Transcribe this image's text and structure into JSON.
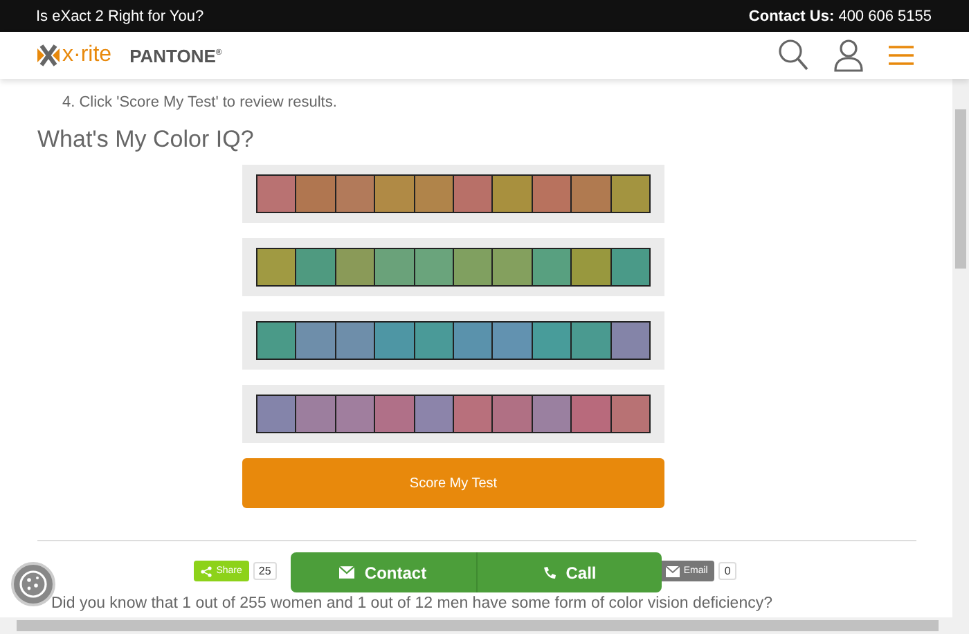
{
  "top_bar": {
    "promo_link": "Is eXact 2 Right for You?",
    "contact_label": "Contact Us:",
    "contact_phone": "400 606 5155"
  },
  "header": {
    "logo_text": "x·rite",
    "brand": "PANTONE",
    "brand_mark": "®"
  },
  "instructions": [
    "4. Click 'Score My Test' to review results."
  ],
  "title": "What's My Color IQ?",
  "swatch_rows": [
    {
      "tiles": [
        {
          "color": "#b97272"
        },
        {
          "color": "#b07650"
        },
        {
          "color": "#b27a5a"
        },
        {
          "color": "#b08a45"
        },
        {
          "color": "#b0844a"
        },
        {
          "color": "#b87068"
        },
        {
          "color": "#a8903e"
        },
        {
          "color": "#b8725e"
        },
        {
          "color": "#b07a50"
        },
        {
          "color": "#a39440"
        }
      ]
    },
    {
      "tiles": [
        {
          "color": "#a09a42"
        },
        {
          "color": "#4f9a80"
        },
        {
          "color": "#8a9a58"
        },
        {
          "color": "#6aa27a"
        },
        {
          "color": "#6aa47c"
        },
        {
          "color": "#80a060"
        },
        {
          "color": "#84a05e"
        },
        {
          "color": "#58a080"
        },
        {
          "color": "#98983e"
        },
        {
          "color": "#4a9a88"
        }
      ]
    },
    {
      "tiles": [
        {
          "color": "#4a9a88"
        },
        {
          "color": "#6e8eaa"
        },
        {
          "color": "#6e8eaa"
        },
        {
          "color": "#4e96a4"
        },
        {
          "color": "#4a9a98"
        },
        {
          "color": "#5a92ac"
        },
        {
          "color": "#6292b0"
        },
        {
          "color": "#489c9a"
        },
        {
          "color": "#4a9a90"
        },
        {
          "color": "#8484a8"
        }
      ]
    },
    {
      "tiles": [
        {
          "color": "#8484aa"
        },
        {
          "color": "#9c7e9e"
        },
        {
          "color": "#a07e9e"
        },
        {
          "color": "#b07088"
        },
        {
          "color": "#8c84aa"
        },
        {
          "color": "#b8707c"
        },
        {
          "color": "#b07084"
        },
        {
          "color": "#9a80a0"
        },
        {
          "color": "#b86a7c"
        },
        {
          "color": "#b87274"
        }
      ]
    }
  ],
  "score_button": "Score My Test",
  "share": {
    "share_label": "Share",
    "share_count": "25",
    "email_label": "Email",
    "email_count": "0"
  },
  "fact": "Did you know that 1 out of 255 women and 1 out of 12 men have some form of color vision deficiency?",
  "contact_bar": {
    "contact": "Contact",
    "call": "Call"
  }
}
